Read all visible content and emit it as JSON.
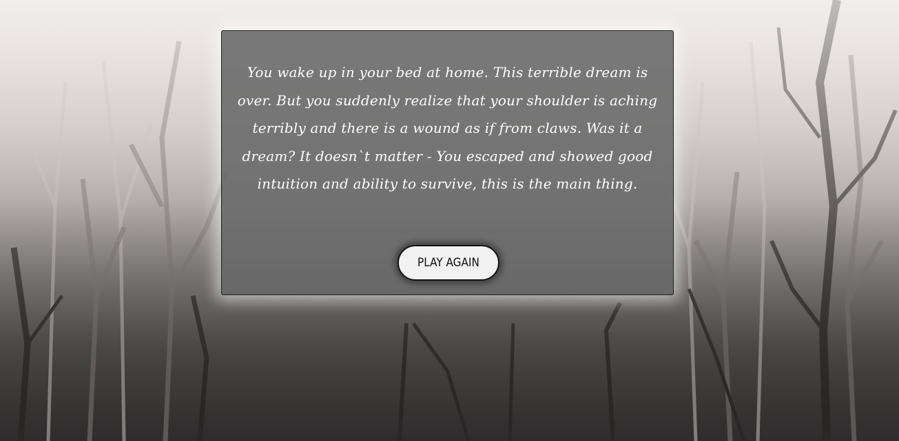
{
  "scene": {
    "background": "misty-dead-forest"
  },
  "panel": {
    "story_text": "You wake up in your bed at home. This terrible dream is over. But you suddenly realize that your shoulder is aching terribly and there is a wound as if from claws. Was it a dream? It doesn`t matter - You escaped and showed good intuition and ability to survive, this is the main thing.",
    "play_again_label": "PLAY AGAIN"
  },
  "colors": {
    "panel_bg": "#696969",
    "text": "#ffffff",
    "button_bg": "#f1f1f1",
    "button_border": "#111111"
  }
}
